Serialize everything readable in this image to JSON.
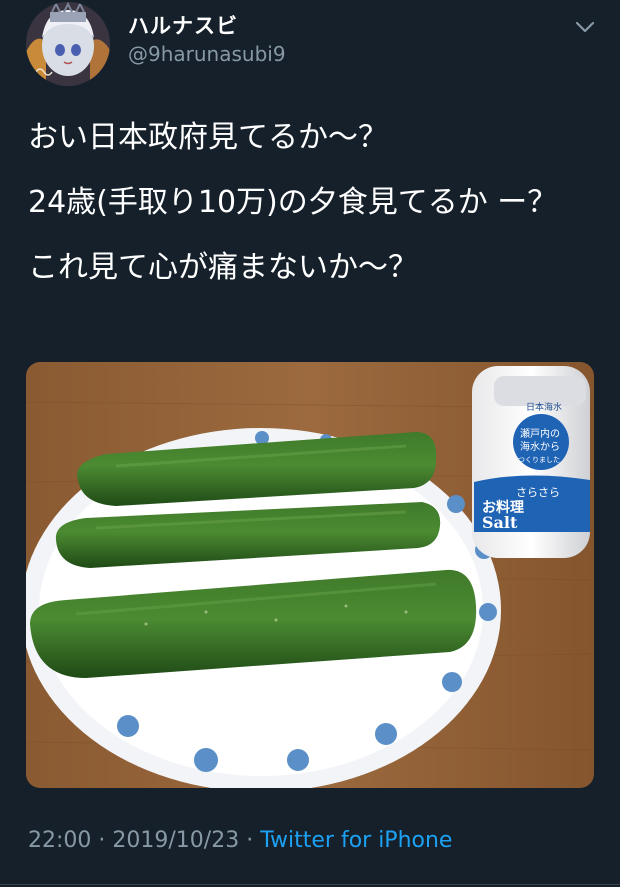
{
  "author": {
    "display_name": "ハルナスビ",
    "handle": "@9harunasubi9"
  },
  "tweet": {
    "lines": [
      "おい日本政府見てるか〜？",
      "24歳(手取り10万)の夕食見てるか ー？",
      "これ見て心が痛まないか〜？"
    ]
  },
  "media": {
    "salt_label": {
      "brand_small": "日本海水",
      "origin": "瀬戸内の",
      "origin_2": "海水から",
      "made": "つくりました",
      "sara": "さらさら",
      "cooking": "お料理",
      "salt": "Salt"
    }
  },
  "meta": {
    "time": "22:00",
    "date": "2019/10/23",
    "source": "Twitter for iPhone"
  },
  "colors": {
    "background": "#15202b",
    "secondary_text": "#8899a6",
    "link": "#1da1f2"
  }
}
